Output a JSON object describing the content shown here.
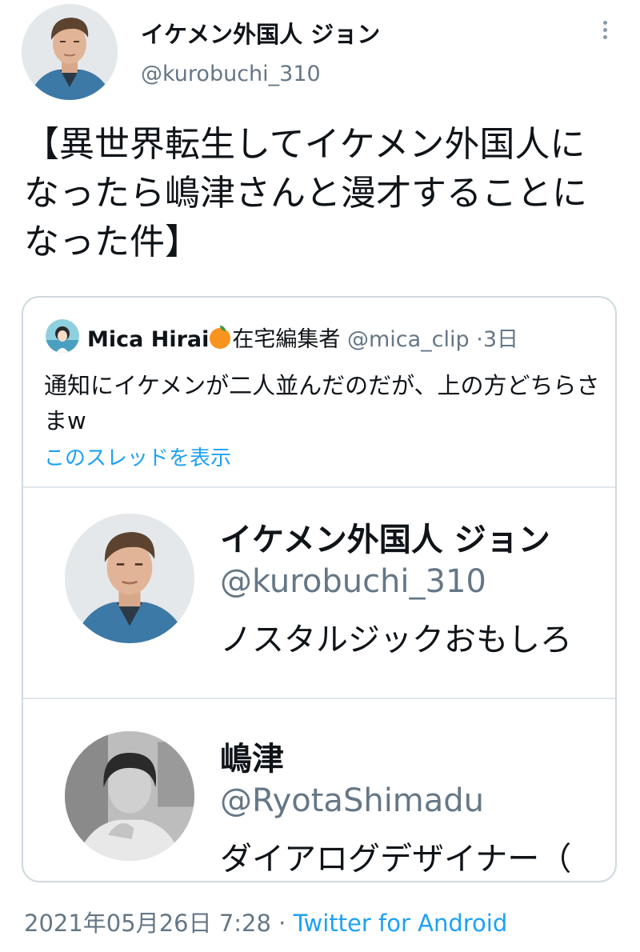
{
  "author": {
    "name": "イケメン外国人 ジョン",
    "handle": "@kurobuchi_310"
  },
  "tweet": {
    "text": "【異世界転生してイケメン外国人になったら嶋津さんと漫才することになった件】"
  },
  "quote": {
    "name": "Mica Hirai",
    "emoji_icon": "orange-emoji",
    "bio_short": "在宅編集者",
    "handle": "@mica_clip",
    "separator": "·",
    "time": "3日",
    "text": "通知にイケメンが二人並んだのだが、上の方どちらさまw",
    "thread_link": "このスレッドを表示",
    "cards": [
      {
        "name": "イケメン外国人 ジョン",
        "handle": "@kurobuchi_310",
        "bio": "ノスタルジックおもしろ"
      },
      {
        "name": "嶋津",
        "handle": "@RyotaShimadu",
        "bio": "ダイアログデザイナー（"
      }
    ]
  },
  "footer": {
    "datetime": "2021年05月26日 7:28",
    "separator": "·",
    "client": "Twitter for Android"
  },
  "colors": {
    "link": "#1da1f2",
    "secondary": "#657786",
    "border": "#cfd9de"
  }
}
